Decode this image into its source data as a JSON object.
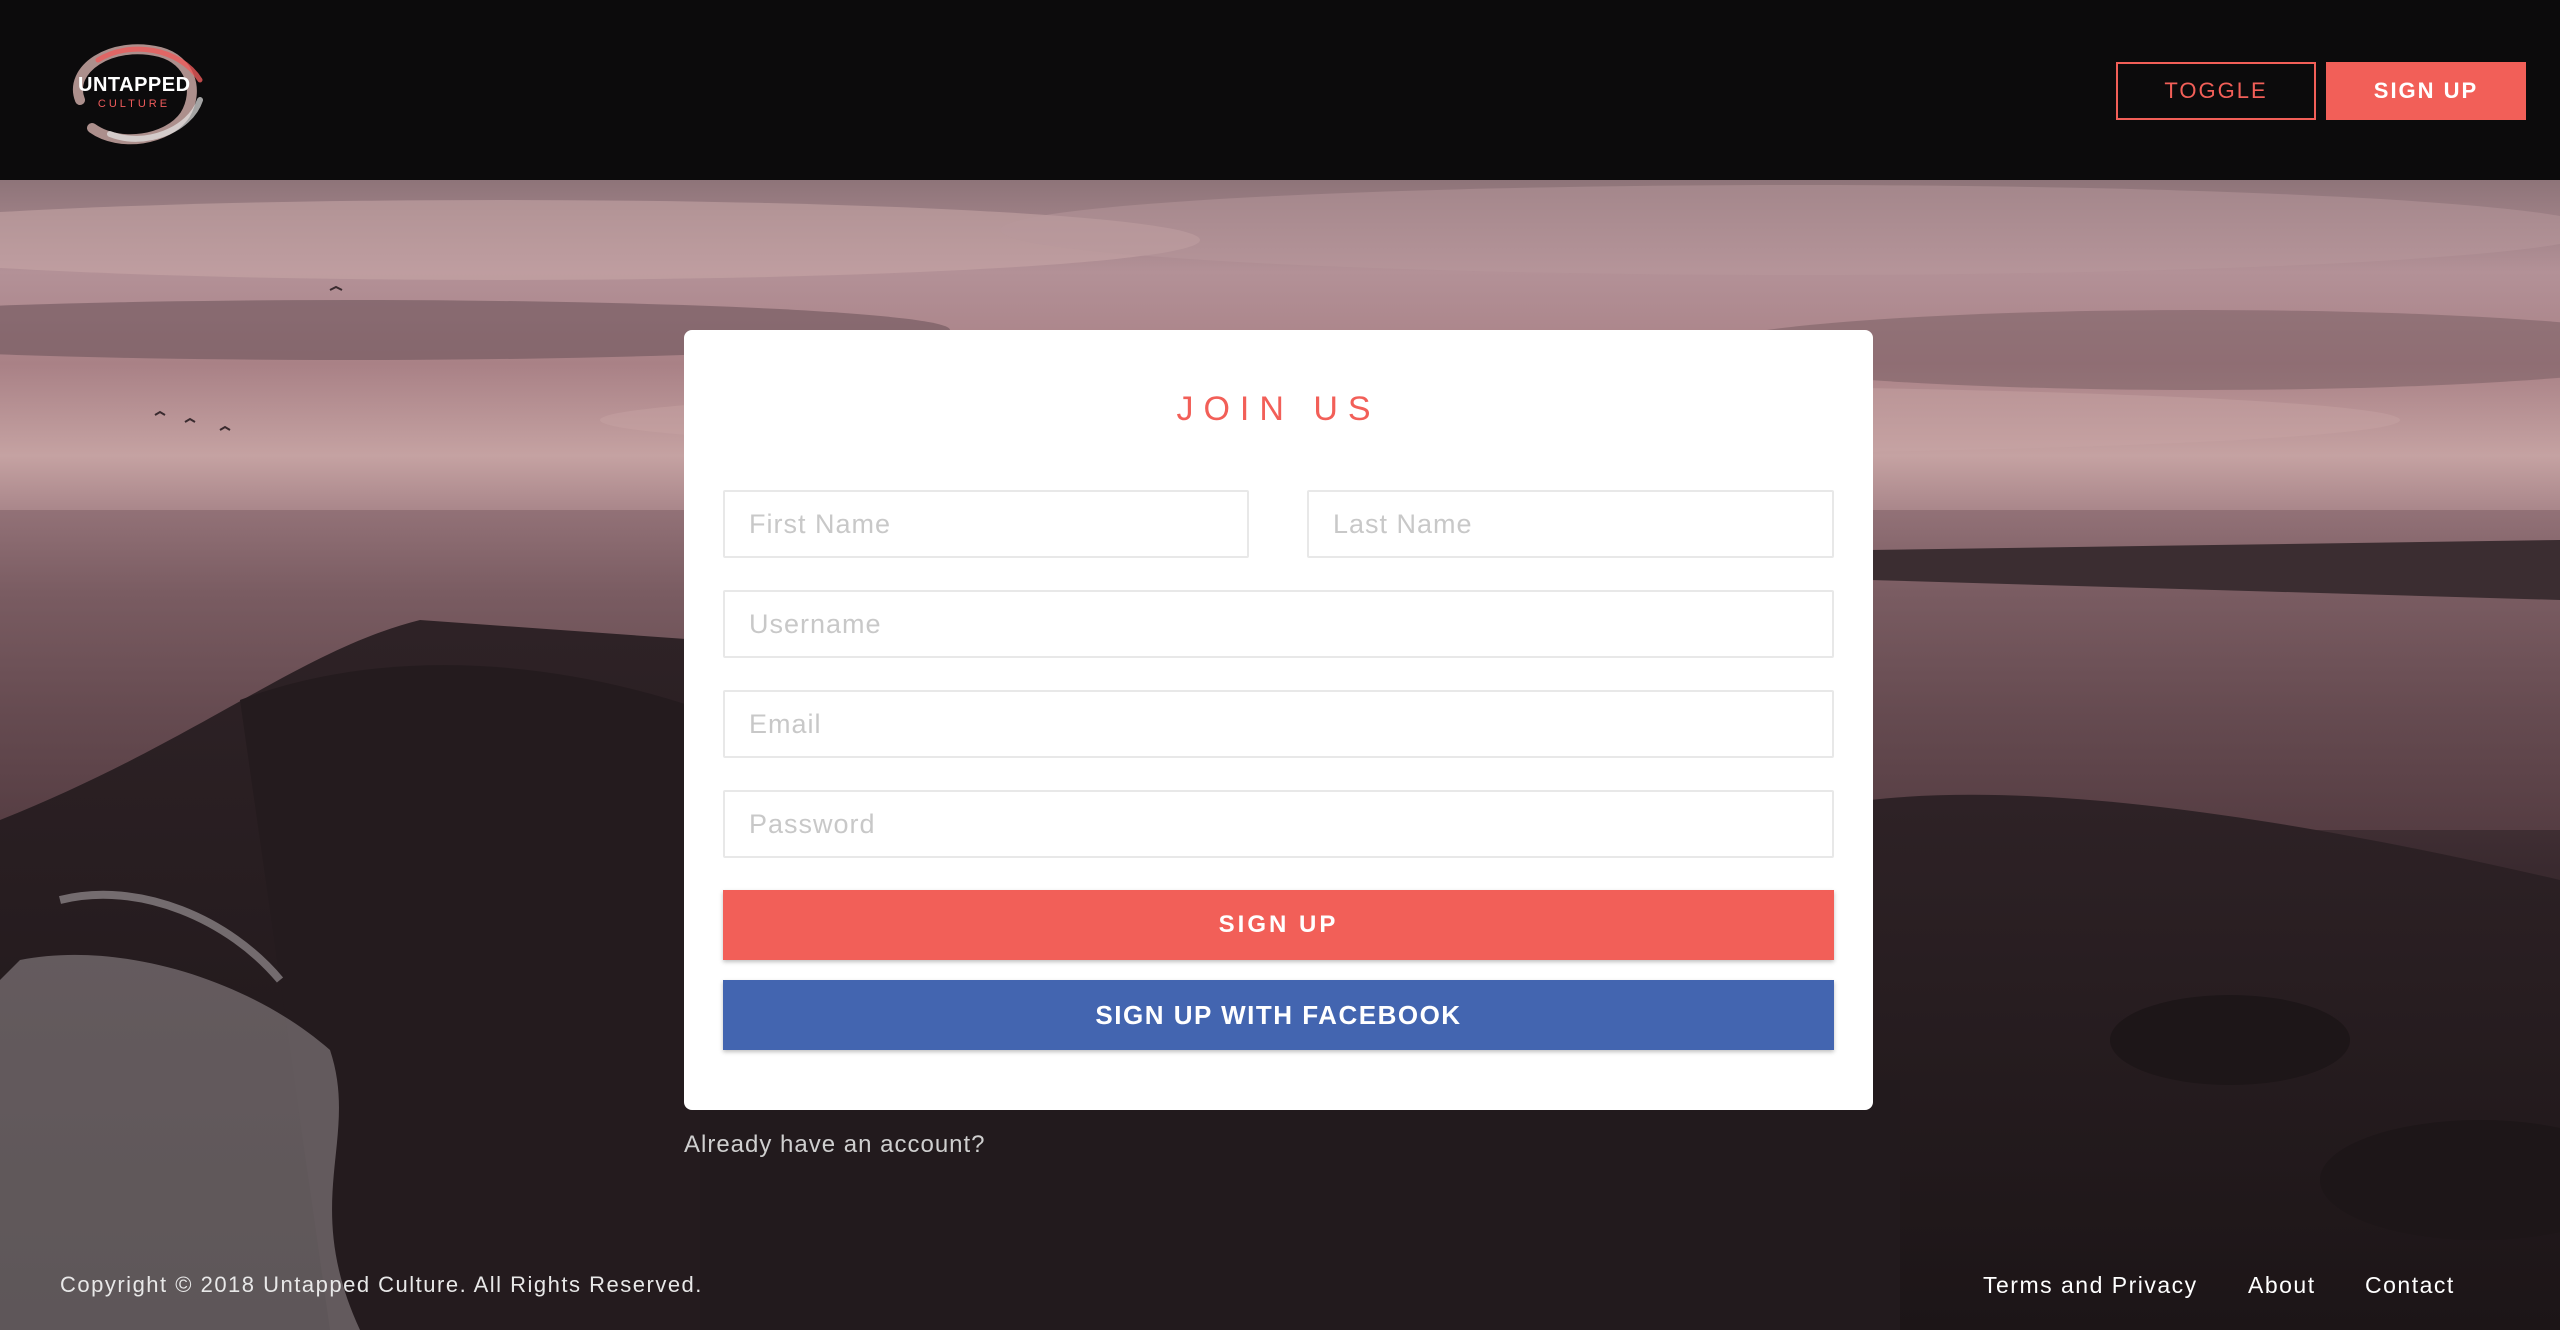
{
  "brand": {
    "name": "UNTAPPED",
    "sub": "CULTURE"
  },
  "header": {
    "toggle_label": "TOGGLE",
    "signup_label": "SIGN UP"
  },
  "form": {
    "title": "JOIN US",
    "first_name_placeholder": "First Name",
    "last_name_placeholder": "Last Name",
    "username_placeholder": "Username",
    "email_placeholder": "Email",
    "password_placeholder": "Password",
    "signup_label": "SIGN UP",
    "facebook_label": "SIGN UP WITH FACEBOOK"
  },
  "login_prompt": "Already have an account?",
  "footer": {
    "copyright": "Copyright © 2018 Untapped Culture. All Rights Reserved.",
    "links": [
      "Terms and Privacy",
      "About",
      "Contact"
    ]
  },
  "colors": {
    "accent": "#f25f58",
    "facebook": "#4365b0",
    "header_bg": "#0c0b0c"
  }
}
